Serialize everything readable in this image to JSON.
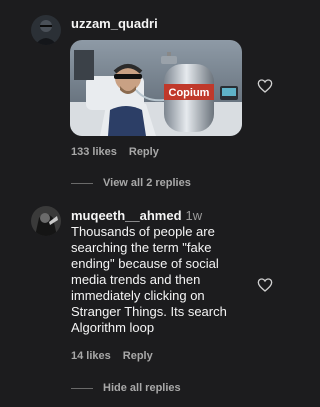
{
  "comments": [
    {
      "username": "uzzam_quadri",
      "time": "",
      "image_label": "Copium",
      "likes": "133 likes",
      "reply_label": "Reply",
      "replies_toggle": "View all 2 replies"
    },
    {
      "username": "muqeeth__ahmed",
      "time": "1w",
      "text": "Thousands of people are searching the term \"fake ending\" because of social media trends and then immediately clicking on Stranger Things. Its search Algorithm loop",
      "likes": "14 likes",
      "reply_label": "Reply",
      "replies_toggle": "Hide all replies"
    }
  ],
  "colors": {
    "background": "#1c1c1e",
    "primary_text": "#f5f5f5",
    "secondary_text": "#a8a8a8",
    "tank_label": "#c0392b"
  },
  "icons": {
    "like": "heart-outline-icon"
  }
}
